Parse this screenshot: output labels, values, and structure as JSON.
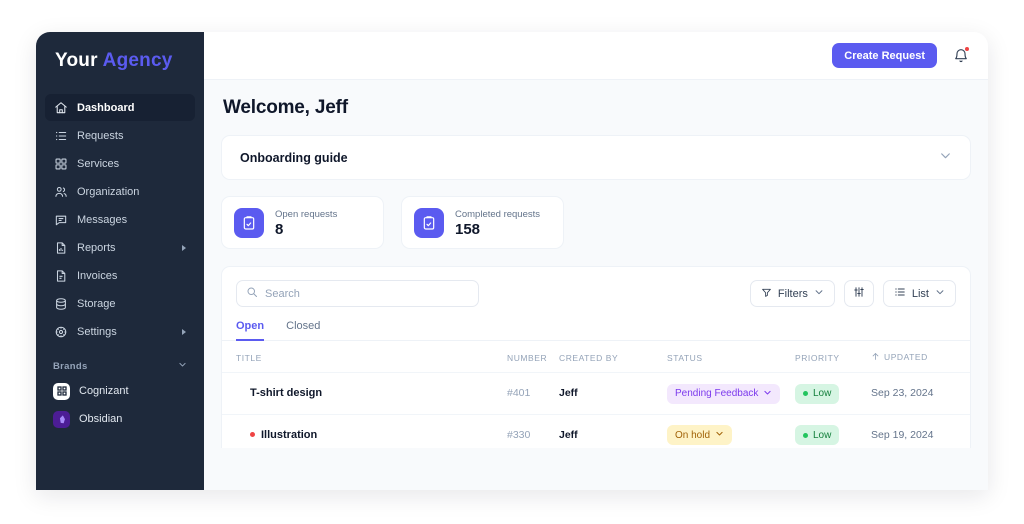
{
  "brand": {
    "word1": "Your",
    "word2": "Agency"
  },
  "sidebar": {
    "items": [
      {
        "label": "Dashboard",
        "icon": "home-icon",
        "active": true,
        "expandable": false
      },
      {
        "label": "Requests",
        "icon": "list-icon",
        "active": false,
        "expandable": false
      },
      {
        "label": "Services",
        "icon": "grid-icon",
        "active": false,
        "expandable": false
      },
      {
        "label": "Organization",
        "icon": "users-icon",
        "active": false,
        "expandable": false
      },
      {
        "label": "Messages",
        "icon": "chat-icon",
        "active": false,
        "expandable": false
      },
      {
        "label": "Reports",
        "icon": "report-icon",
        "active": false,
        "expandable": true
      },
      {
        "label": "Invoices",
        "icon": "invoice-icon",
        "active": false,
        "expandable": false
      },
      {
        "label": "Storage",
        "icon": "database-icon",
        "active": false,
        "expandable": false
      },
      {
        "label": "Settings",
        "icon": "gear-icon",
        "active": false,
        "expandable": true
      }
    ],
    "brands_section": {
      "label": "Brands"
    },
    "brands": [
      {
        "label": "Cognizant",
        "icon": "cognizant-logo-icon"
      },
      {
        "label": "Obsidian",
        "icon": "obsidian-logo-icon"
      }
    ]
  },
  "topbar": {
    "create_request_label": "Create Request",
    "bell_icon": "notification-bell-icon",
    "has_unread": true
  },
  "page": {
    "title": "Welcome, Jeff"
  },
  "onboarding": {
    "title": "Onboarding guide",
    "chevron": "chevron-down-icon"
  },
  "stats": [
    {
      "label": "Open requests",
      "value": "8",
      "icon": "clipboard-icon"
    },
    {
      "label": "Completed requests",
      "value": "158",
      "icon": "clipboard-icon"
    }
  ],
  "search": {
    "placeholder": "Search",
    "value": "",
    "icon": "search-icon"
  },
  "tools": {
    "filters_label": "Filters",
    "filters_icon": "funnel-icon",
    "settings_icon": "sliders-icon",
    "view_label": "List",
    "view_icon": "list-view-icon",
    "chevron": "chevron-down-icon"
  },
  "tabs": [
    {
      "label": "Open",
      "active": true
    },
    {
      "label": "Closed",
      "active": false
    }
  ],
  "table": {
    "columns": [
      "TITLE",
      "NUMBER",
      "CREATED BY",
      "STATUS",
      "PRIORITY",
      "UPDATED"
    ],
    "sorted_column": "UPDATED",
    "sort_direction": "asc",
    "rows": [
      {
        "title": "T-shirt design",
        "flagged": false,
        "number": "#401",
        "created_by": "Jeff",
        "status": "Pending Feedback",
        "status_style": "status-purple",
        "priority": "Low",
        "priority_style": "prio-green",
        "updated": "Sep 23, 2024"
      },
      {
        "title": "Illustration",
        "flagged": true,
        "number": "#330",
        "created_by": "Jeff",
        "status": "On hold",
        "status_style": "status-yellow",
        "priority": "Low",
        "priority_style": "prio-green",
        "updated": "Sep 19, 2024"
      }
    ]
  },
  "colors": {
    "accent": "#5b5bf0",
    "sidebar_bg": "#1e293b",
    "status_purple_bg": "#f3e8fd",
    "status_yellow_bg": "#fef3c7",
    "priority_green_bg": "#d6f5e3",
    "alert_red": "#ef4444"
  }
}
